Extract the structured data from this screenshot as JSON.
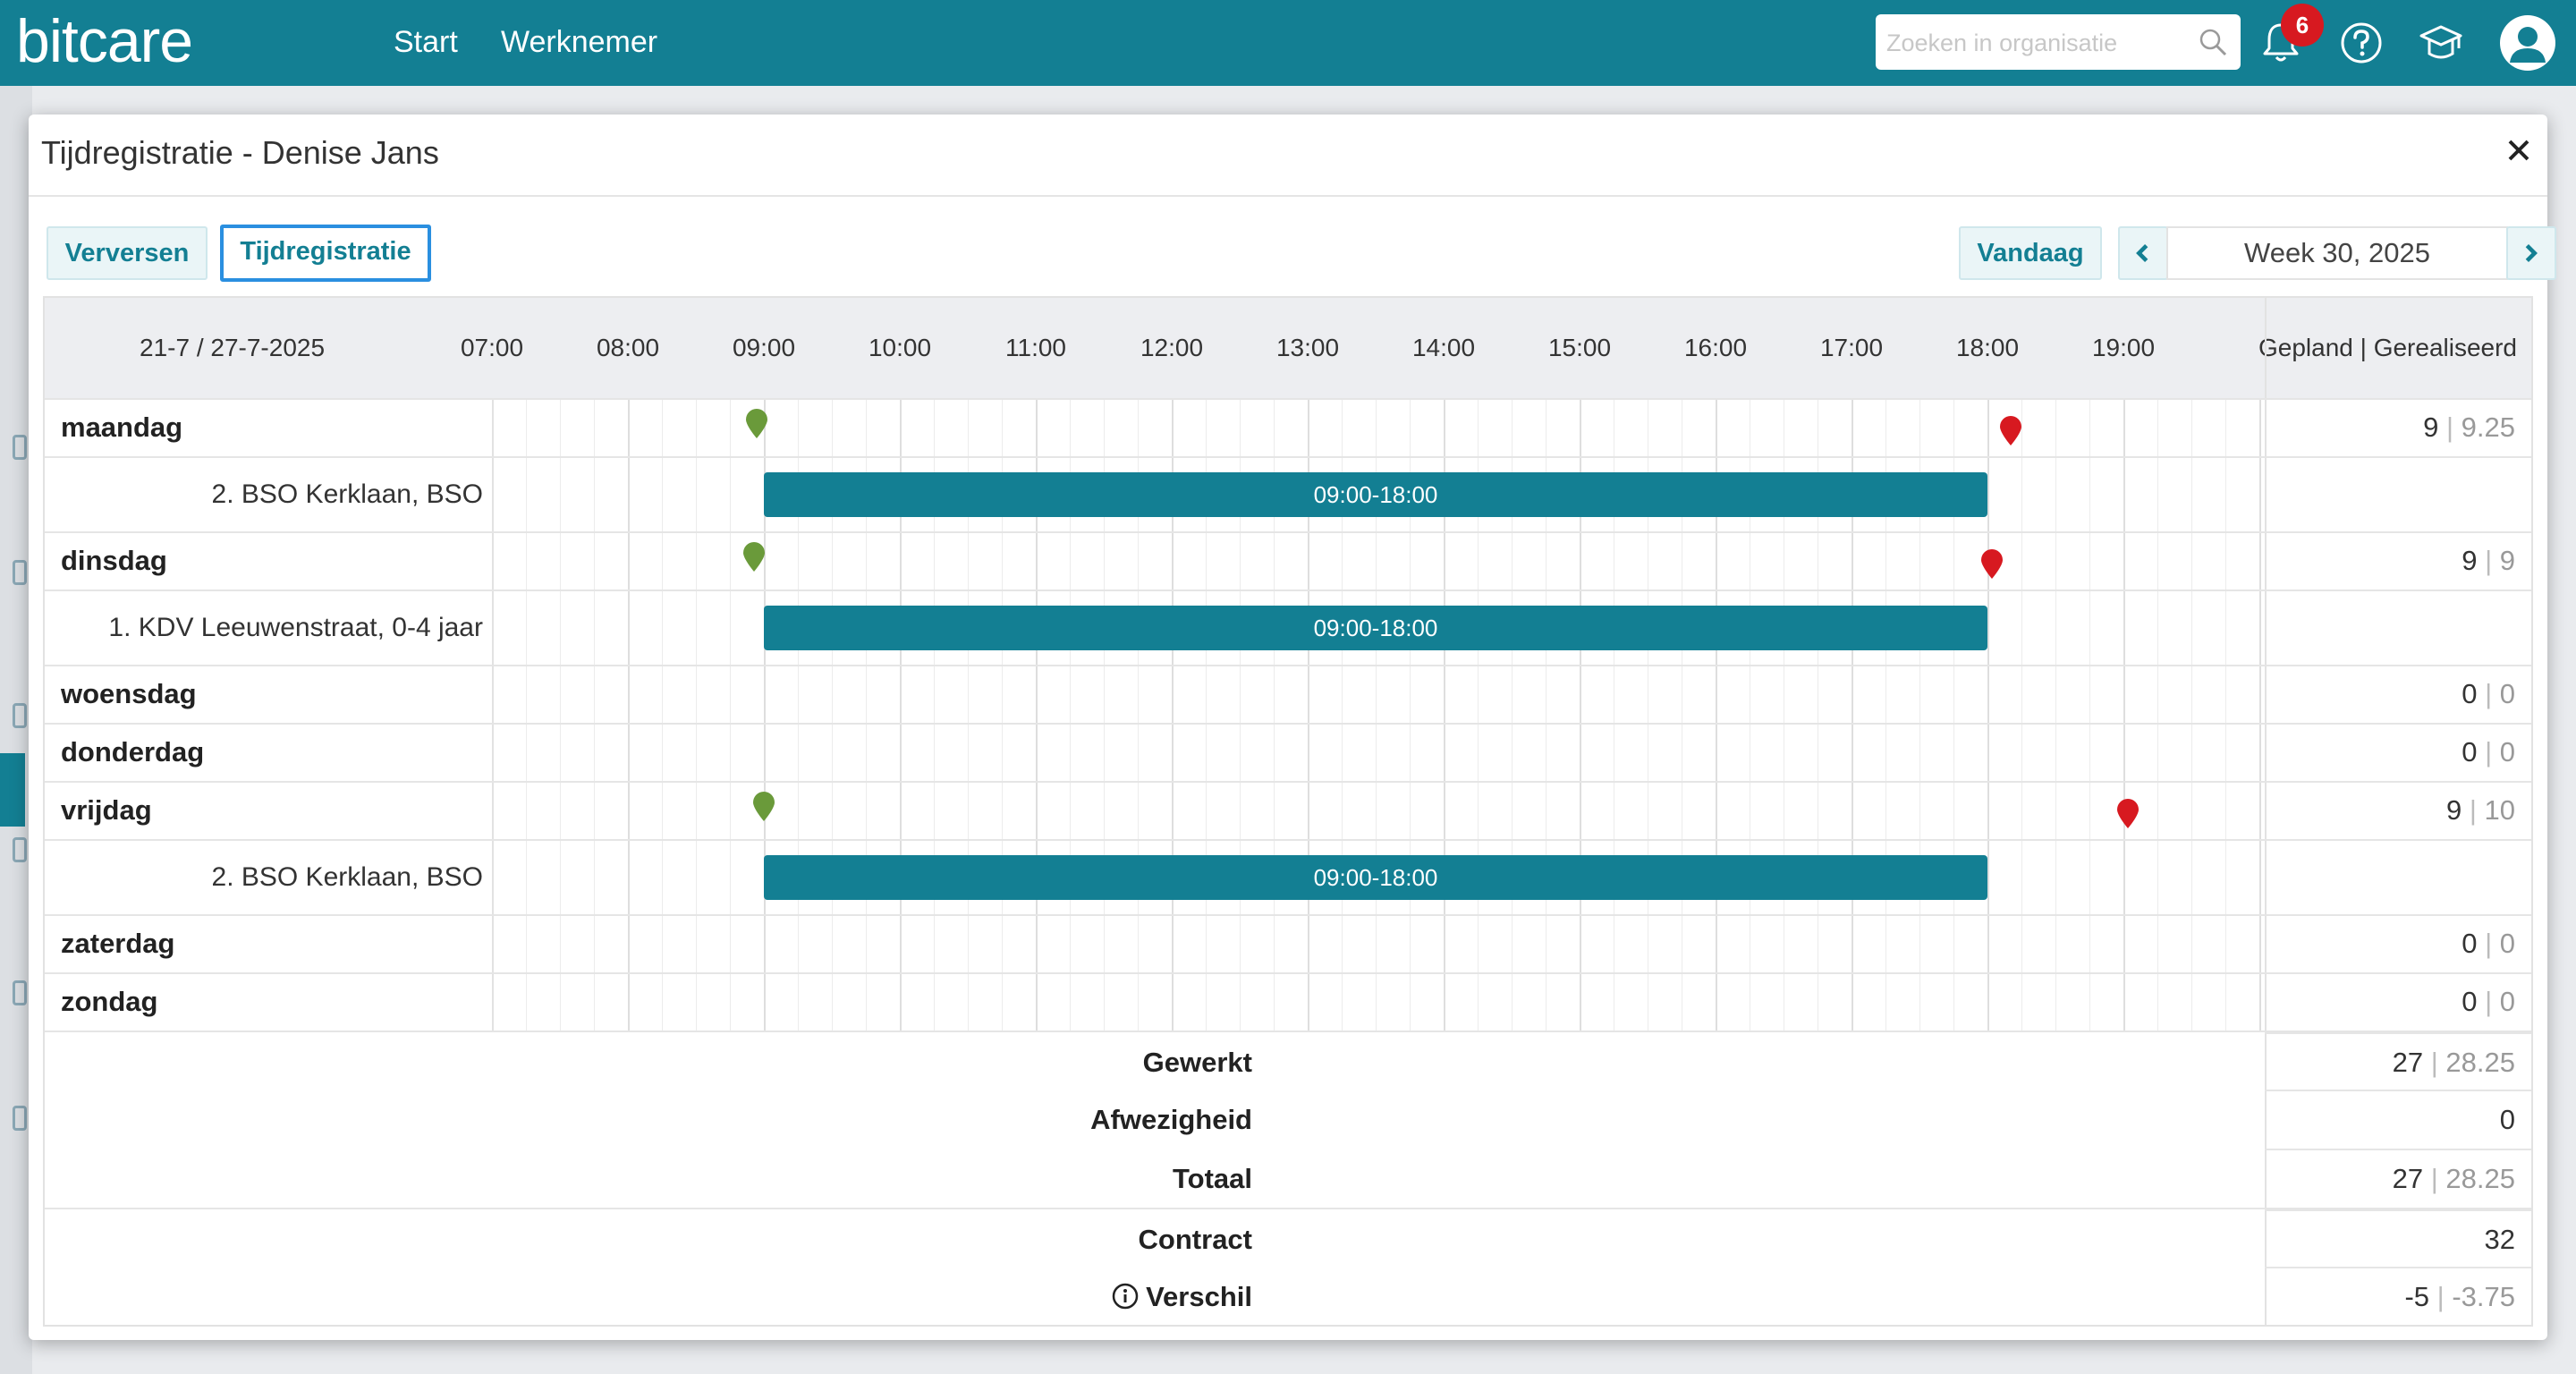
{
  "app": {
    "logo": "bitcare",
    "nav": [
      "Start",
      "Werknemer"
    ]
  },
  "search": {
    "placeholder": "Zoeken in organisatie"
  },
  "notifications": {
    "count": "6"
  },
  "modal": {
    "title": "Tijdregistratie - Denise Jans",
    "buttons": {
      "refresh": "Verversen",
      "timereg": "Tijdregistratie",
      "today": "Vandaag"
    },
    "week_label": "Week 30, 2025"
  },
  "grid": {
    "date_range": "21-7 / 27-7-2025",
    "hours": [
      "07:00",
      "08:00",
      "09:00",
      "10:00",
      "11:00",
      "12:00",
      "13:00",
      "14:00",
      "15:00",
      "16:00",
      "17:00",
      "18:00",
      "19:00"
    ],
    "totals_header": "Gepland | Gerealiseerd",
    "days": [
      {
        "name": "maandag",
        "planned": "9",
        "realized": "9.25",
        "checkin": 8.95,
        "checkout": 18.17,
        "shifts": [
          {
            "location": "2. BSO Kerklaan, BSO",
            "label": "09:00-18:00",
            "start": 9,
            "end": 18
          }
        ]
      },
      {
        "name": "dinsdag",
        "planned": "9",
        "realized": "9",
        "checkin": 8.93,
        "checkout": 18.03,
        "shifts": [
          {
            "location": "1. KDV Leeuwenstraat, 0-4 jaar",
            "label": "09:00-18:00",
            "start": 9,
            "end": 18
          }
        ]
      },
      {
        "name": "woensdag",
        "planned": "0",
        "realized": "0",
        "shifts": []
      },
      {
        "name": "donderdag",
        "planned": "0",
        "realized": "0",
        "shifts": []
      },
      {
        "name": "vrijdag",
        "planned": "9",
        "realized": "10",
        "checkin": 9.0,
        "checkout": 19.03,
        "shifts": [
          {
            "location": "2. BSO Kerklaan, BSO",
            "label": "09:00-18:00",
            "start": 9,
            "end": 18
          }
        ]
      },
      {
        "name": "zaterdag",
        "planned": "0",
        "realized": "0",
        "shifts": []
      },
      {
        "name": "zondag",
        "planned": "0",
        "realized": "0",
        "shifts": []
      }
    ],
    "summary": [
      {
        "label": "Gewerkt",
        "planned": "27",
        "realized": "28.25"
      },
      {
        "label": "Afwezigheid",
        "value": "0"
      },
      {
        "label": "Totaal",
        "planned": "27",
        "realized": "28.25"
      },
      {
        "label": "Contract",
        "value": "32"
      },
      {
        "label": "Verschil",
        "planned": "-5",
        "realized": "-3.75",
        "info_icon": "info-icon"
      }
    ]
  },
  "colors": {
    "brand": "#137f93",
    "checkin": "#6a9a3a",
    "checkout": "#d71920",
    "badge": "#d71920"
  }
}
